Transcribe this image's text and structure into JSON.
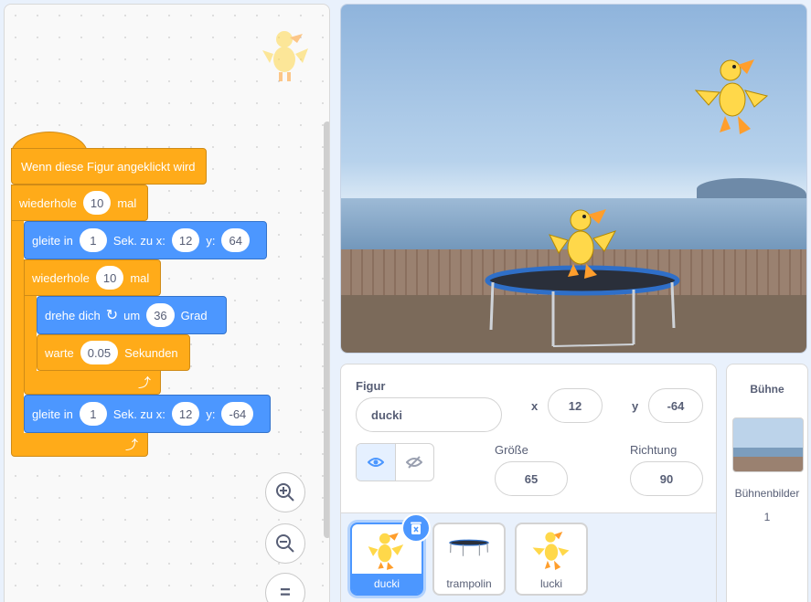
{
  "code": {
    "hat": "Wenn diese Figur angeklickt wird",
    "repeat_outer": {
      "label": "wiederhole",
      "count": "10",
      "suffix": "mal"
    },
    "glide1": {
      "prefix": "gleite in",
      "secs": "1",
      "mid": "Sek. zu x:",
      "x": "12",
      "ylabel": "y:",
      "y": "64"
    },
    "repeat_inner": {
      "label": "wiederhole",
      "count": "10",
      "suffix": "mal"
    },
    "turn": {
      "prefix": "drehe dich",
      "mid": "um",
      "deg": "36",
      "suffix": "Grad"
    },
    "wait": {
      "prefix": "warte",
      "secs": "0.05",
      "suffix": "Sekunden"
    },
    "glide2": {
      "prefix": "gleite in",
      "secs": "1",
      "mid": "Sek. zu x:",
      "x": "12",
      "ylabel": "y:",
      "y": "-64"
    },
    "zoom_reset_symbol": "="
  },
  "sprite_info": {
    "figur_label": "Figur",
    "name": "ducki",
    "x_label": "x",
    "x": "12",
    "y_label": "y",
    "y": "-64",
    "size_label": "Größe",
    "size": "65",
    "direction_label": "Richtung",
    "direction": "90"
  },
  "sprites": [
    {
      "name": "ducki",
      "selected": true
    },
    {
      "name": "trampolin",
      "selected": false
    },
    {
      "name": "lucki",
      "selected": false
    }
  ],
  "stage_panel": {
    "title": "Bühne",
    "backdrops_label": "Bühnenbilder",
    "backdrops_count": "1"
  },
  "colors": {
    "events": "#ffab19",
    "control": "#ffab19",
    "motion": "#4c97ff"
  }
}
